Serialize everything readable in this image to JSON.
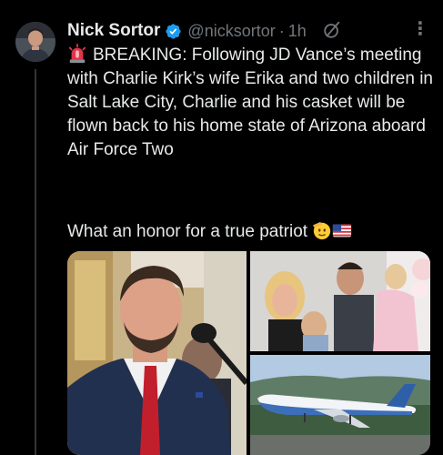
{
  "tweet": {
    "author": {
      "display_name": "Nick Sortor",
      "handle": "@nicksortor",
      "verified": true,
      "avatar_icon": "avatar-photo"
    },
    "separator": "·",
    "timestamp": "1h",
    "more_label": "⋮",
    "grok_icon": "grok-icon",
    "body": "BREAKING: Following JD Vance’s meeting with Charlie Kirk’s wife Erika and two children in Salt Lake City, Charlie and his casket will be flown back to his home state of Arizona aboard Air Force Two",
    "siren_icon": "siren-icon",
    "closing_line": "What an honor for a true patriot",
    "closing_emojis": [
      "saluting-face-icon",
      "us-flag-icon"
    ],
    "media": [
      {
        "name": "media-photo-vance",
        "kind": "photo"
      },
      {
        "name": "media-photo-family",
        "kind": "photo"
      },
      {
        "name": "media-photo-air-force-two",
        "kind": "photo"
      }
    ],
    "colors": {
      "background": "#000000",
      "text": "#e7e9ea",
      "muted": "#71767b",
      "verified": "#1d9bf0"
    }
  }
}
